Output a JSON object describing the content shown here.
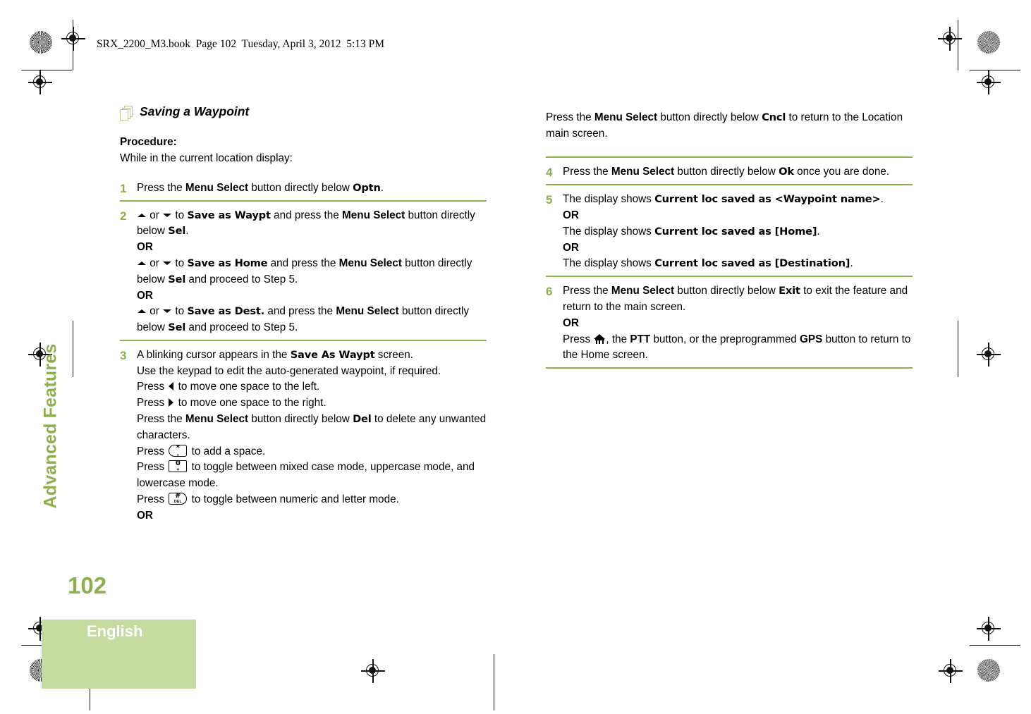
{
  "book_header": "SRX_2200_M3.book  Page 102  Tuesday, April 3, 2012  5:13 PM",
  "side_tab": "Advanced Features",
  "page_number": "102",
  "language": "English",
  "colors": {
    "accent_green": "#8cb04b",
    "icon_green": "#b3cd87",
    "lang_box_green": "#c5dba0"
  },
  "section": {
    "heading": "Saving a Waypoint",
    "procedure_label": "Procedure:",
    "intro": "While in the current location display:"
  },
  "steps": {
    "s1": {
      "num": "1",
      "t1": "Press the ",
      "b1": "Menu Select",
      "t2": " button directly below ",
      "scr1": "Optn",
      "t3": "."
    },
    "s2": {
      "num": "2",
      "a_or": " or ",
      "a_to": " to ",
      "scr1": "Save as Waypt",
      "t1": " and press the ",
      "b1": "Menu Select",
      "t2": " button directly below ",
      "scr2": "Sel",
      "t3": ".",
      "or1": "OR",
      "scr3": "Save as Home",
      "t4": " and press the ",
      "b2": "Menu Select",
      "t5": " button directly below ",
      "scr4": "Sel",
      "t6": " and proceed to Step 5.",
      "or2": "OR",
      "scr5": "Save as Dest.",
      "t7": " and press the ",
      "b3": "Menu Select",
      "t8": " button directly below ",
      "scr6": "Sel",
      "t9": " and proceed to Step 5."
    },
    "s3": {
      "num": "3",
      "t1": "A blinking cursor appears in the ",
      "scr1": "Save As Waypt",
      "t2": " screen.",
      "l2": "Use the keypad to edit the auto-generated waypoint, if required.",
      "l3a": "Press ",
      "l3b": " to move one space to the left.",
      "l4a": "Press ",
      "l4b": " to move one space to the right.",
      "l5a": "Press the ",
      "l5b": "Menu Select",
      "l5c": " button directly below ",
      "l5scr": "Del",
      "l5d": " to delete any unwanted characters.",
      "l6a": "Press ",
      "l6b": " to add a space.",
      "l7a": "Press ",
      "l7b": " to toggle between mixed case mode, uppercase mode, and lowercase mode.",
      "l8a": "Press ",
      "l8b": " to toggle between numeric and letter mode.",
      "or": "OR"
    },
    "s3_cont": {
      "t1": "Press the ",
      "b1": "Menu Select",
      "t2": " button directly below ",
      "scr1": "Cncl",
      "t3": " to return to the Location main screen."
    },
    "s4": {
      "num": "4",
      "t1": "Press the ",
      "b1": "Menu Select",
      "t2": " button directly below ",
      "scr1": "Ok",
      "t3": " once you are done."
    },
    "s5": {
      "num": "5",
      "t1": "The display shows ",
      "scr1": "Current loc saved as <Waypoint name>",
      "t2": ".",
      "or1": "OR",
      "t3": "The display shows ",
      "scr2": "Current loc saved as [Home]",
      "t4": ".",
      "or2": "OR",
      "t5": "The display shows ",
      "scr3": "Current loc saved as [Destination]",
      "t6": "."
    },
    "s6": {
      "num": "6",
      "t1": "Press the ",
      "b1": "Menu Select",
      "t2": " button directly below ",
      "scr1": "Exit",
      "t3": " to exit the feature and return to the main screen.",
      "or": "OR",
      "t4": "Press ",
      "t5": ", the ",
      "b2": "PTT",
      "t6": " button, or the preprogrammed ",
      "b3": "GPS",
      "t7": " button to return to the Home screen."
    }
  },
  "keycaps": {
    "star": {
      "main": "*",
      "sub": "␣"
    },
    "zero": {
      "main": "0",
      "sub": "⍦"
    },
    "hash": {
      "main": "#",
      "sub": "DEL"
    }
  }
}
